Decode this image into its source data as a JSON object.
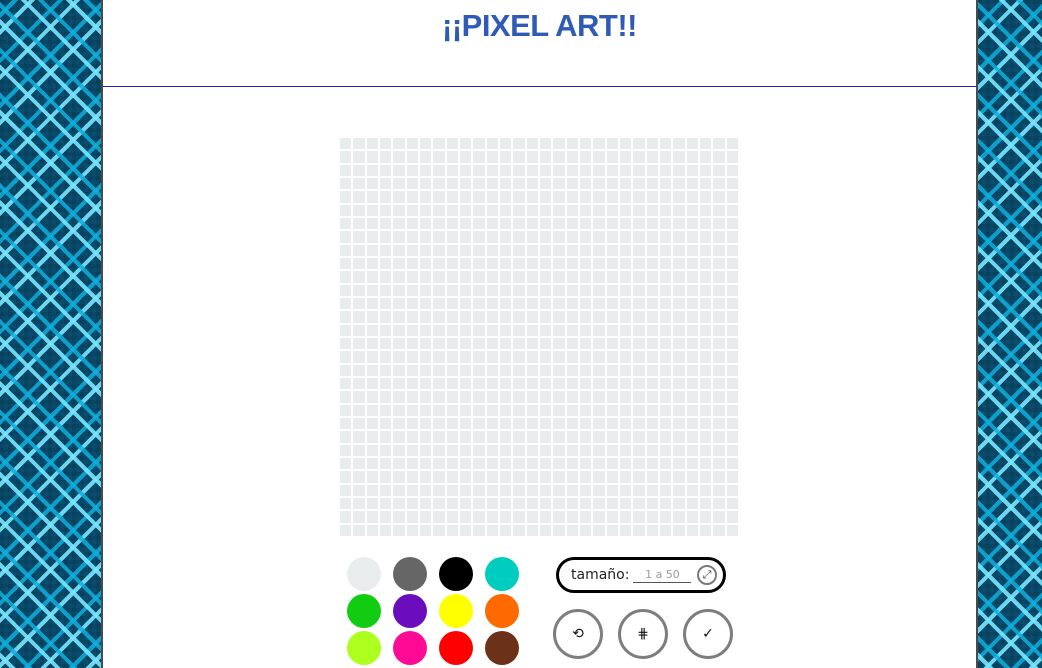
{
  "header": {
    "title": "¡¡PIXEL ART!!"
  },
  "grid": {
    "columns": 30,
    "rows": 30,
    "cell_color": "#e9eced"
  },
  "palette": [
    {
      "name": "light-gray",
      "color": "#e9eced"
    },
    {
      "name": "dark-gray",
      "color": "#666666"
    },
    {
      "name": "black",
      "color": "#000000"
    },
    {
      "name": "turquoise",
      "color": "#00cdc0"
    },
    {
      "name": "green",
      "color": "#12cc12"
    },
    {
      "name": "purple",
      "color": "#6a0dbd"
    },
    {
      "name": "yellow",
      "color": "#ffff00"
    },
    {
      "name": "orange",
      "color": "#ff6a00"
    },
    {
      "name": "lime",
      "color": "#adff1e"
    },
    {
      "name": "pink",
      "color": "#ff0a94"
    },
    {
      "name": "red",
      "color": "#ff0000"
    },
    {
      "name": "brown",
      "color": "#6b3219"
    }
  ],
  "size": {
    "label": "tamaño:",
    "placeholder": "1 a 50",
    "apply_icon": "⤢"
  },
  "tools": {
    "reset_icon": "⟲",
    "grid_icon": "⋕",
    "done_icon": "✓"
  },
  "theme": {
    "title_color": "#2f5bb7",
    "header_line": "#1d27a8",
    "side_pattern": [
      "#0a4d6e",
      "#1eaee0",
      "#7ce6ff"
    ]
  }
}
